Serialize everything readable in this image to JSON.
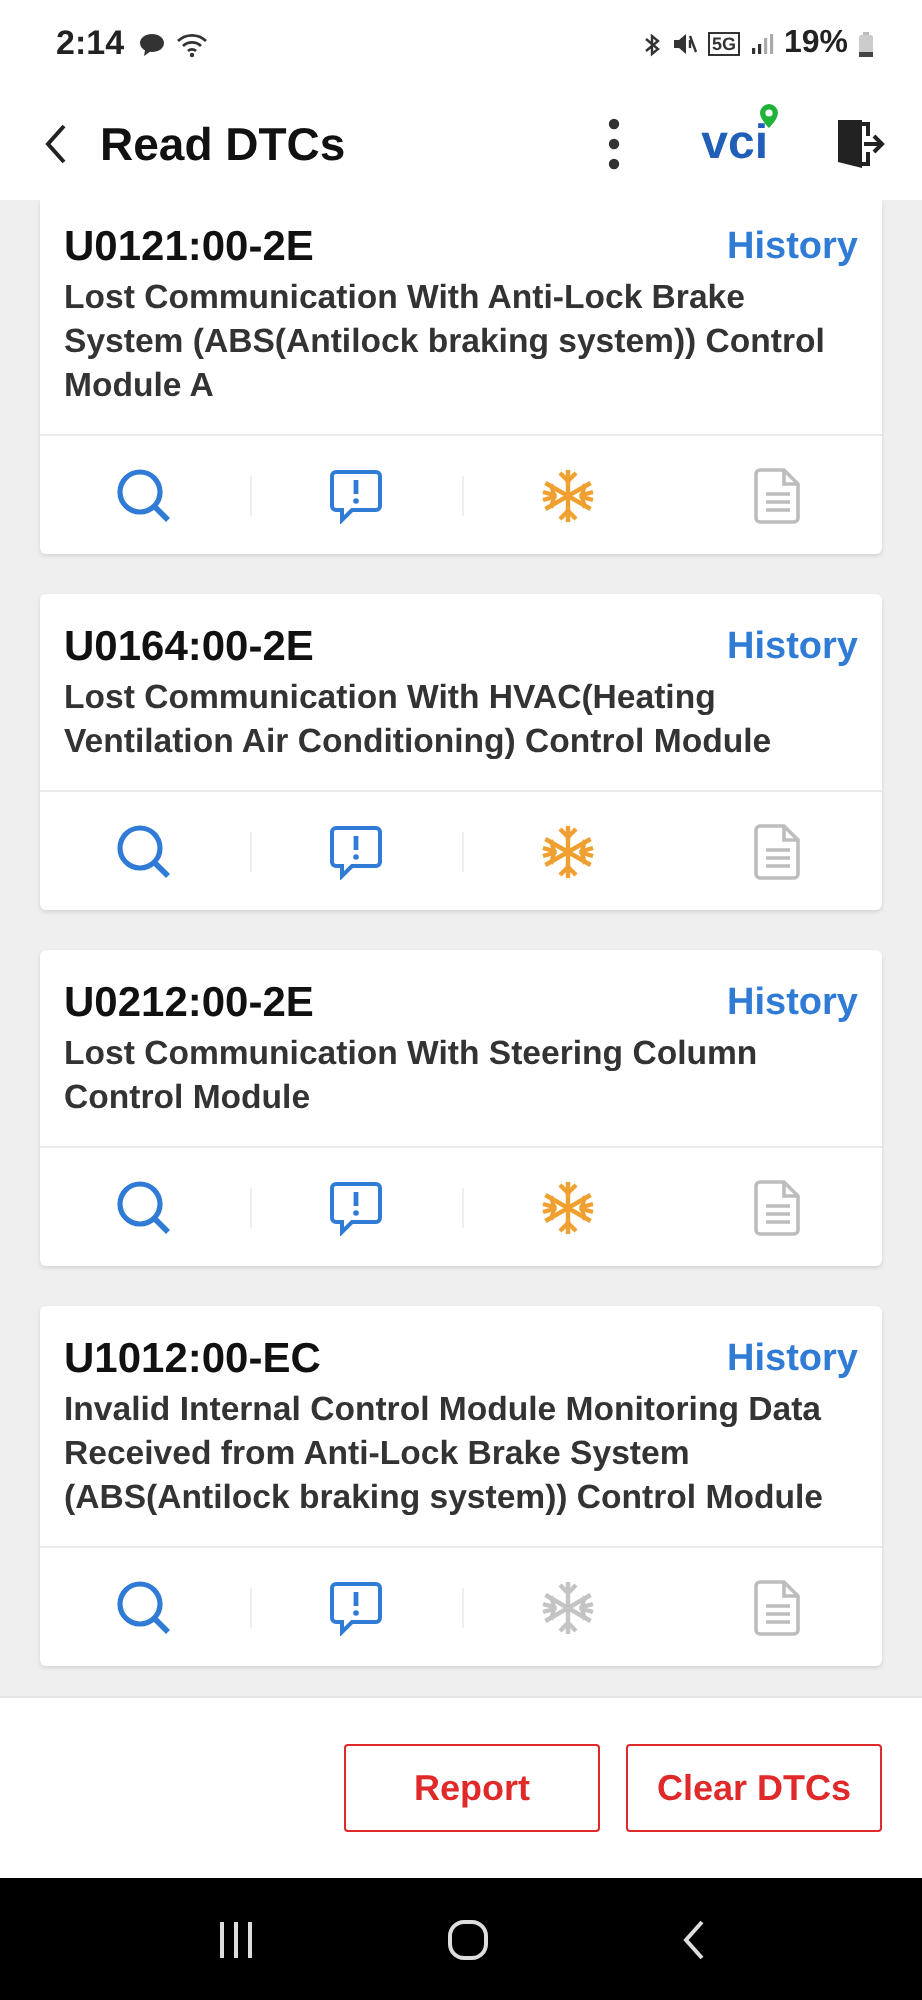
{
  "status_bar": {
    "time": "2:14",
    "network": "5G",
    "battery": "19%"
  },
  "header": {
    "title": "Read DTCs",
    "vci_label": "vci"
  },
  "dtcs": [
    {
      "code": "U0121:00-2E",
      "status": "History",
      "description": "Lost Communication With Anti-Lock Brake System (ABS(Antilock braking system)) Control Module A",
      "freeze_frame_available": true
    },
    {
      "code": "U0164:00-2E",
      "status": "History",
      "description": "Lost Communication With HVAC(Heating Ventilation Air Conditioning) Control Module",
      "freeze_frame_available": true
    },
    {
      "code": "U0212:00-2E",
      "status": "History",
      "description": "Lost Communication With Steering Column Control Module",
      "freeze_frame_available": true
    },
    {
      "code": "U1012:00-EC",
      "status": "History",
      "description": "Invalid Internal Control Module Monitoring Data Received from Anti-Lock Brake System (ABS(Antilock braking system)) Control Module",
      "freeze_frame_available": false
    }
  ],
  "buttons": [
    "Report",
    "Clear DTCs"
  ]
}
